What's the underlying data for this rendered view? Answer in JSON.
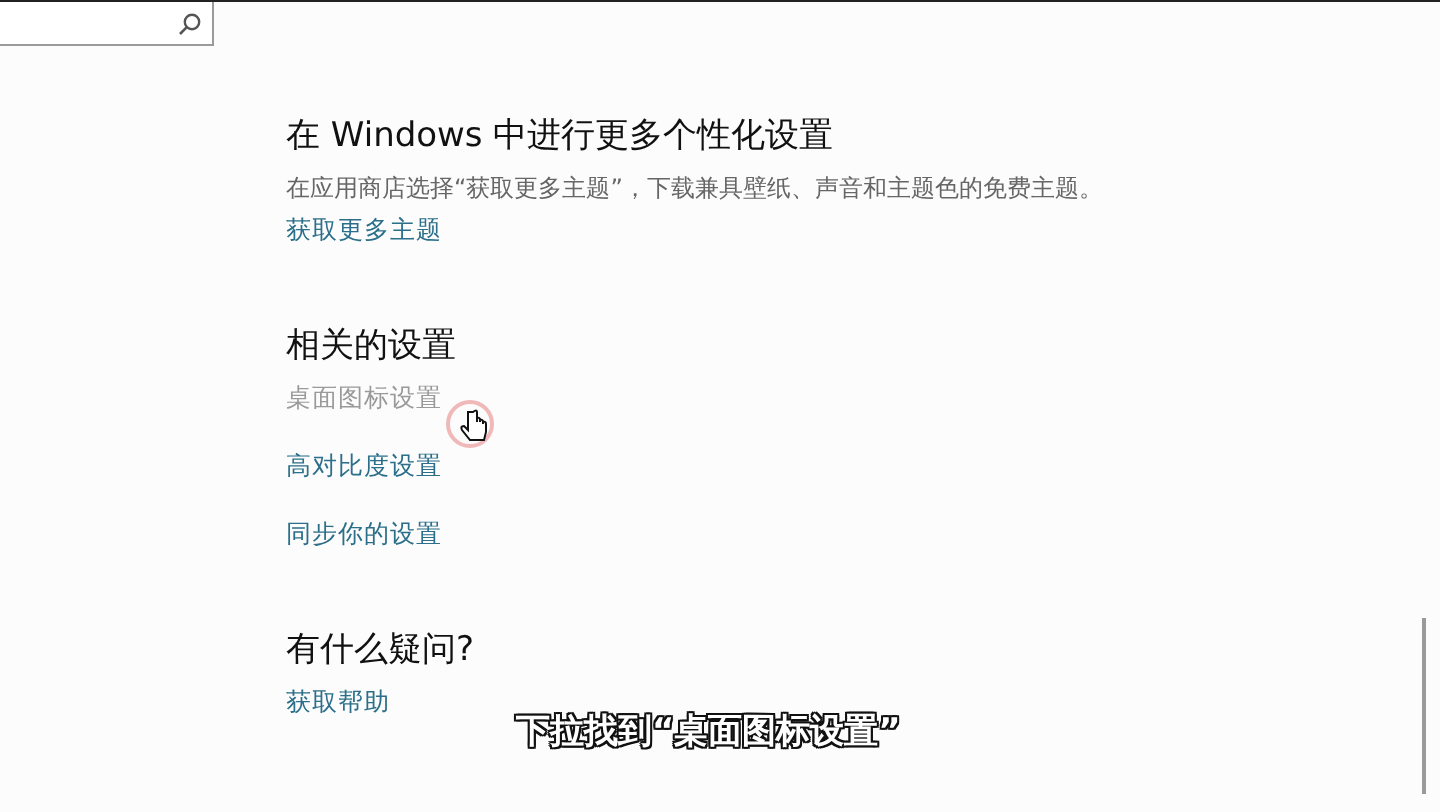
{
  "sections": [
    {
      "heading": "在 Windows 中进行更多个性化设置",
      "description": "在应用商店选择“获取更多主题”，下载兼具壁纸、声音和主题色的免费主题。",
      "links": [
        {
          "label": "获取更多主题",
          "pressed": false
        }
      ]
    },
    {
      "heading": "相关的设置",
      "links": [
        {
          "label": "桌面图标设置",
          "pressed": true
        },
        {
          "label": "高对比度设置",
          "pressed": false
        },
        {
          "label": "同步你的设置",
          "pressed": false
        }
      ]
    },
    {
      "heading": "有什么疑问?",
      "links": [
        {
          "label": "获取帮助",
          "pressed": false
        }
      ]
    }
  ],
  "subtitle": "下拉找到“桌面图标设置”"
}
